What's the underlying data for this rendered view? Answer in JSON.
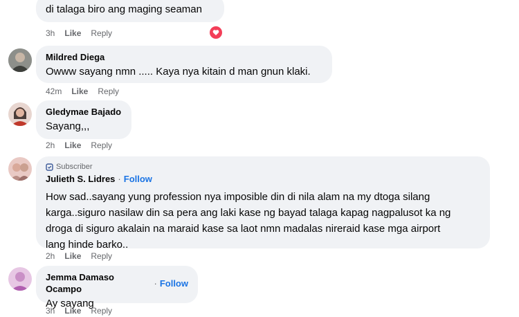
{
  "comments": [
    {
      "text": "di talaga biro ang maging seaman",
      "time": "3h",
      "like": "Like",
      "reply": "Reply",
      "reaction": "love-icon"
    },
    {
      "author": "Mildred Diega",
      "text": "Owww sayang nmn ..... Kaya nya kitain d man gnun klaki.",
      "time": "42m",
      "like": "Like",
      "reply": "Reply"
    },
    {
      "author": "Gledymae Bajado",
      "text": "Sayang,,,",
      "time": "2h",
      "like": "Like",
      "reply": "Reply"
    },
    {
      "badge": "Subscriber",
      "author": "Julieth S. Lidres",
      "separator": "·",
      "follow": "Follow",
      "text_lines": [
        "How sad..sayang yung profession nya imposible din di nila alam na my dtoga silang",
        "karga..siguro nasilaw din sa pera ang laki kase ng bayad talaga kapag nagpalusot ka ng",
        "droga di siguro akalain na maraid kase sa laot nmn madalas nireraid kase mga airport",
        "lang hinde barko.."
      ],
      "time": "2h",
      "like": "Like",
      "reply": "Reply"
    },
    {
      "author": "Jemma Damaso Ocampo",
      "separator": "·",
      "follow": "Follow",
      "text": "Ay sayang",
      "time": "3h",
      "like": "Like",
      "reply": "Reply"
    }
  ],
  "colors": {
    "bubble": "#f0f2f5",
    "meta": "#65676b",
    "follow": "#1b74e4",
    "love": "#f33e58"
  }
}
